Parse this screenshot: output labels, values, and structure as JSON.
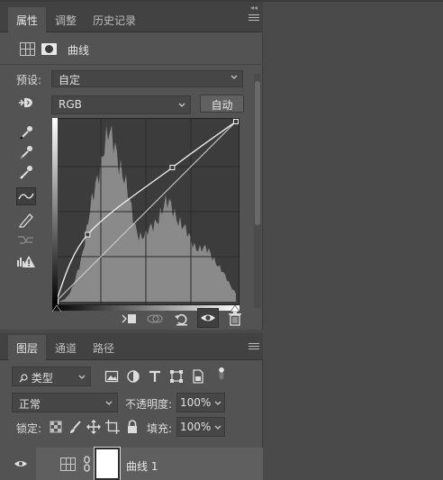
{
  "properties_panel": {
    "tabs": [
      "属性",
      "调整",
      "历史记录"
    ],
    "active_tab": "属性",
    "adjustment_name": "曲线",
    "preset_label": "预设:",
    "preset_value": "自定",
    "channel_value": "RGB",
    "auto_label": "自动",
    "tools": [
      "on-image-adjust-icon",
      "black-point-eyedropper-icon",
      "gray-point-eyedropper-icon",
      "white-point-eyedropper-icon",
      "curve-tool-icon",
      "pencil-icon",
      "smooth-icon",
      "clipping-warning-icon"
    ],
    "bottom_icons": [
      "clip-to-layer-icon",
      "view-previous-icon",
      "reset-icon",
      "visibility-icon",
      "delete-icon"
    ]
  },
  "layers_panel": {
    "tabs": [
      "图层",
      "通道",
      "路径"
    ],
    "active_tab": "图层",
    "filter_label": "类型",
    "blend_mode": "正常",
    "opacity_label": "不透明度:",
    "opacity_value": "100%",
    "lock_label": "锁定:",
    "fill_label": "填充:",
    "fill_value": "100%",
    "layer_name": "曲线 1"
  },
  "chart_data": {
    "type": "line",
    "xlim": [
      0,
      255
    ],
    "ylim": [
      0,
      255
    ],
    "grid": "4x4",
    "series": [
      {
        "points": [
          [
            0,
            0
          ],
          [
            45,
            95
          ],
          [
            165,
            190
          ],
          [
            255,
            255
          ]
        ]
      },
      {
        "points": [
          [
            0,
            0
          ],
          [
            255,
            255
          ]
        ]
      }
    ]
  }
}
